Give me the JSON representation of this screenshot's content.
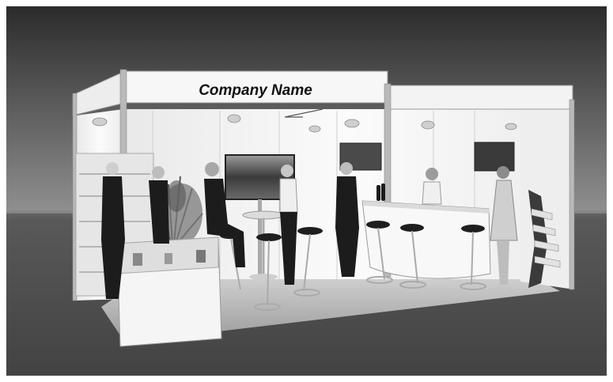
{
  "scene": {
    "fascia_title": "Company Name",
    "palette": {
      "backdrop_top": "#2e2e2e",
      "backdrop_mid": "#8a8a8a",
      "floor_dark": "#3c3c3c",
      "floor_light": "#6d6d6d",
      "wall_white": "#f4f4f4",
      "frame_grey": "#b9b9b9",
      "figure_dark": "#1c1c1c"
    },
    "icons": [
      "spotlight-icon",
      "brochure-rack-icon",
      "plant-icon"
    ]
  }
}
